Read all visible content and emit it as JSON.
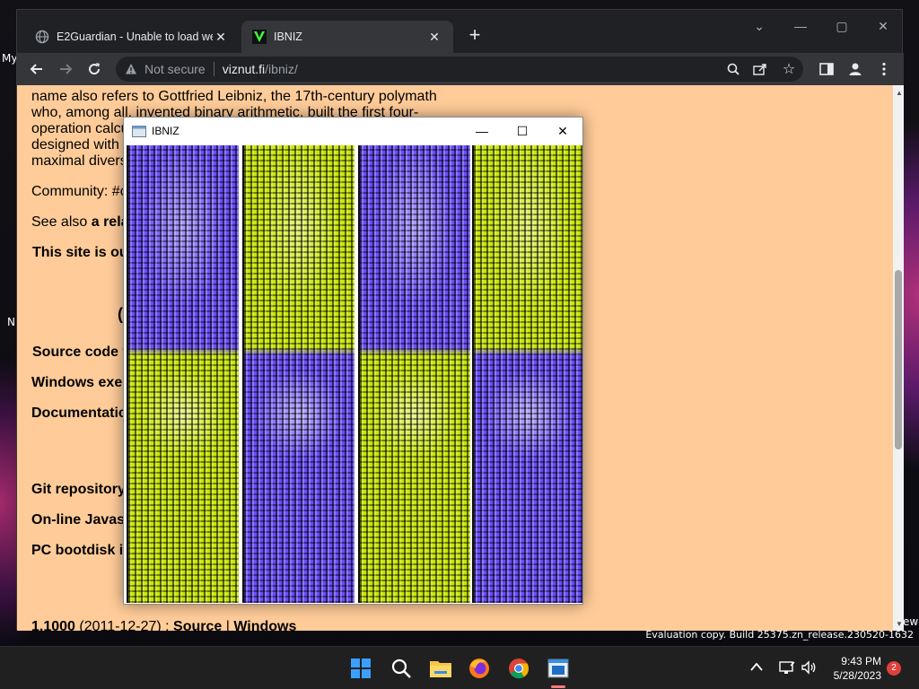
{
  "desktop": {
    "edge_label_top": "My",
    "edge_label_mid": "N",
    "edge_label_right": "ew",
    "watermark": "Evaluation copy. Build 25375.zn_release.230520-1632"
  },
  "browser": {
    "tabs": [
      {
        "title": "E2Guardian - Unable to load web",
        "icon": "globe-icon",
        "active": false
      },
      {
        "title": "IBNIZ",
        "icon": "ibniz-favicon",
        "active": true
      }
    ],
    "address": {
      "security": "Not secure",
      "host": "viznut.fi",
      "path": "/ibniz/"
    }
  },
  "page": {
    "line1": "name also refers to Gottfried Leibniz, the 17th-century polymath",
    "line2": "who, among all, invented binary arithmetic, built the first four-",
    "line3": "operation calculating machine, and believed that the world was",
    "line4": "designed with t",
    "line5": "maximal divers",
    "community": "Community: #",
    "community_tail": "c",
    "see_also_prefix": "See also ",
    "see_also_link": "a rela",
    "site_notice": "This site is ou",
    "paren": "(",
    "source_code": "Source code t",
    "windows_exe": "Windows exe",
    "documentation": "Documentatic",
    "git_repo": "Git repository",
    "online_js": "On-line Javas",
    "pc_bootdisk": "PC bootdisk i",
    "release_version": "1.1000",
    "release_date": " (2011-12-27) : ",
    "release_source": "Source",
    "release_sep": " | ",
    "release_windows": "Windows"
  },
  "ibniz_window": {
    "title": "IBNIZ"
  },
  "taskbar": {
    "time": "9:43 PM",
    "date": "5/28/2023",
    "notification_count": "2",
    "apps": [
      "start-icon",
      "search-icon",
      "file-explorer-icon",
      "firefox-icon",
      "chrome-icon",
      "ibniz-app-icon"
    ]
  },
  "colors": {
    "page_bg": "#ffcc99",
    "ibniz_yellow": "#c8e600",
    "ibniz_blue": "#6a4cff",
    "badge": "#e0403c"
  }
}
